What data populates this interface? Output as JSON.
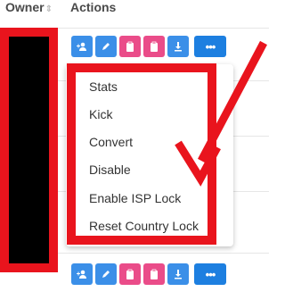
{
  "table": {
    "owner_header": "Owner",
    "actions_header": "Actions"
  },
  "row_actions": {
    "add_user_icon": "add-user-icon",
    "edit_icon": "pencil-icon",
    "clipboard_icon": "clipboard-icon",
    "download_icon": "download-icon",
    "more_label": "•••"
  },
  "dropdown": {
    "items": [
      "Stats",
      "Kick",
      "Convert",
      "Disable",
      "Enable ISP Lock",
      "Reset Country Lock"
    ]
  },
  "colors": {
    "primary": "#3b8fe8",
    "danger_pink": "#ea4c89",
    "annotation_red": "#e9141d"
  }
}
